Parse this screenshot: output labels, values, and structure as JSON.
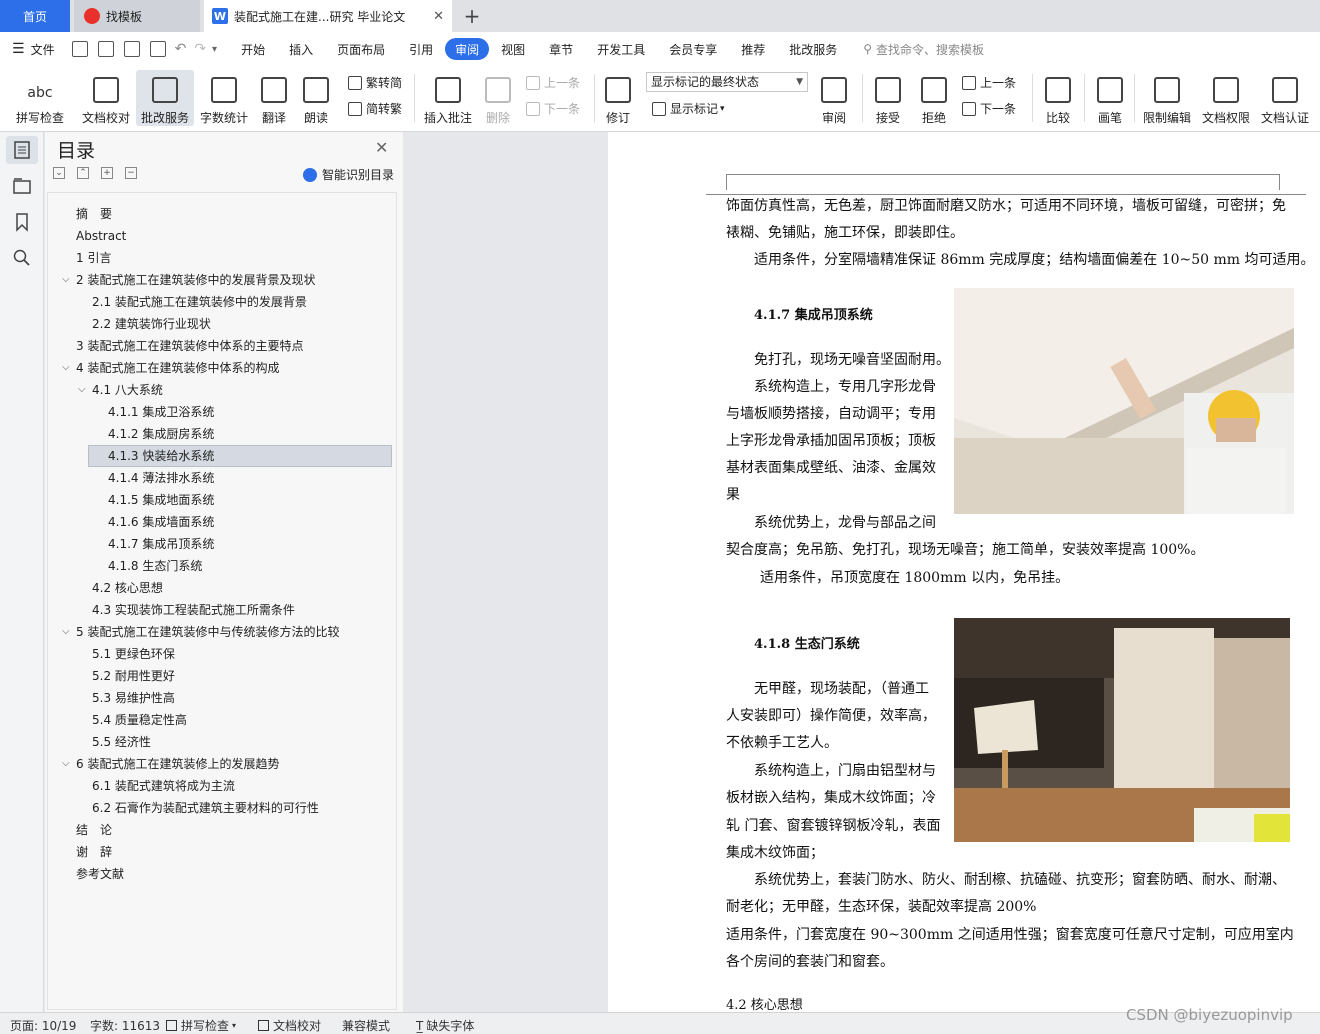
{
  "tabs": {
    "home": "首页",
    "templates": "找模板",
    "document": "装配式施工在建...研究 毕业论文"
  },
  "menu": {
    "file": "文件",
    "items": [
      "开始",
      "插入",
      "页面布局",
      "引用",
      "审阅",
      "视图",
      "章节",
      "开发工具",
      "会员专享",
      "推荐",
      "批改服务"
    ],
    "active": "审阅",
    "search_placeholder": "查找命令、搜索模板"
  },
  "ribbon": {
    "spellcheck": "拼写检查",
    "doc_proof": "文档校对",
    "correct_service": "批改服务",
    "word_count": "字数统计",
    "translate": "翻译",
    "read_aloud": "朗读",
    "trad_to_simp": "繁转简",
    "simp_to_trad": "简转繁",
    "insert_comment": "插入批注",
    "delete": "删除",
    "prev_comment": "上一条",
    "next_comment": "下一条",
    "revise": "修订",
    "markup_mode": "显示标记的最终状态",
    "show_markup": "显示标记",
    "review": "审阅",
    "accept": "接受",
    "reject": "拒绝",
    "prev_change": "上一条",
    "next_change": "下一条",
    "compare": "比较",
    "pen": "画笔",
    "restrict_edit": "限制编辑",
    "doc_rights": "文档权限",
    "doc_cert": "文档认证"
  },
  "nav": {
    "title": "目录",
    "smart_toc": "智能识别目录",
    "items": [
      {
        "text": "摘　要",
        "level": 1
      },
      {
        "text": "Abstract",
        "level": 1
      },
      {
        "text": "1 引言",
        "level": 1
      },
      {
        "text": "2 装配式施工在建筑装修中的发展背景及现状",
        "level": 1,
        "twisty": "⌵"
      },
      {
        "text": "2.1 装配式施工在建筑装修中的发展背景",
        "level": 2
      },
      {
        "text": "2.2 建筑装饰行业现状",
        "level": 2
      },
      {
        "text": "3 装配式施工在建筑装修中体系的主要特点",
        "level": 1
      },
      {
        "text": "4 装配式施工在建筑装修中体系的构成",
        "level": 1,
        "twisty": "⌵"
      },
      {
        "text": "4.1 八大系统",
        "level": 2,
        "twisty": "⌵"
      },
      {
        "text": "4.1.1 集成卫浴系统",
        "level": 3
      },
      {
        "text": "4.1.2 集成厨房系统",
        "level": 3
      },
      {
        "text": "4.1.3 快装给水系统",
        "level": 3,
        "selected": true
      },
      {
        "text": "4.1.4 薄法排水系统",
        "level": 3
      },
      {
        "text": "4.1.5 集成地面系统",
        "level": 3
      },
      {
        "text": "4.1.6 集成墙面系统",
        "level": 3
      },
      {
        "text": "4.1.7 集成吊顶系统",
        "level": 3
      },
      {
        "text": "4.1.8 生态门系统",
        "level": 3
      },
      {
        "text": "4.2 核心思想",
        "level": 2
      },
      {
        "text": "4.3 实现装饰工程装配式施工所需条件",
        "level": 2
      },
      {
        "text": "5 装配式施工在建筑装修中与传统装修方法的比较",
        "level": 1,
        "twisty": "⌵"
      },
      {
        "text": "5.1 更绿色环保",
        "level": 2
      },
      {
        "text": "5.2 耐用性更好",
        "level": 2
      },
      {
        "text": "5.3 易维护性高",
        "level": 2
      },
      {
        "text": "5.4 质量稳定性高",
        "level": 2
      },
      {
        "text": "5.5 经济性",
        "level": 2
      },
      {
        "text": "6 装配式施工在建筑装修上的发展趋势",
        "level": 1,
        "twisty": "⌵"
      },
      {
        "text": "6.1 装配式建筑将成为主流",
        "level": 2
      },
      {
        "text": "6.2 石膏作为装配式建筑主要材料的可行性",
        "level": 2
      },
      {
        "text": "结　论",
        "level": 1
      },
      {
        "text": "谢　辞",
        "level": 1
      },
      {
        "text": "参考文献",
        "level": 1
      }
    ]
  },
  "document": {
    "lines": [
      "饰面仿真性高，无色差，厨卫饰面耐磨又防水；可适用不同环境，墙板可留缝，可密拼；免",
      "裱糊、免铺贴，施工环保，即装即住。",
      "适用条件，分室隔墙精准保证 86mm 完成厚度；结构墙面偏差在 10~50 mm 均可适用。",
      "4.1.7 集成吊顶系统",
      "免打孔，现场无噪音坚固耐用。",
      "系统构造上，专用几字形龙骨",
      "与墙板顺势搭接，自动调平；专用",
      "上字形龙骨承插加固吊顶板；顶板",
      "基材表面集成壁纸、油漆、金属效",
      "果",
      "系统优势上，龙骨与部品之间",
      "契合度高；免吊筋、免打孔，现场无噪音；施工简单，安装效率提高 100%。",
      "适用条件，吊顶宽度在 1800mm 以内，免吊挂。",
      "4.1.8 生态门系统",
      "无甲醛，现场装配，（普通工",
      "人安装即可）操作简便，效率高，",
      "不依赖手工艺人。",
      "系统构造上，门扇由铝型材与",
      "板材嵌入结构，集成木纹饰面；冷",
      "轧 门套、窗套镀锌钢板冷轧，表面",
      "集成木纹饰面；",
      "系统优势上，套装门防水、防火、耐刮檫、抗磕碰、抗变形；窗套防晒、耐水、耐潮、",
      "耐老化；无甲醛，生态环保，装配效率提高 200%",
      "适用条件，门套宽度在 90~300mm 之间适用性强；窗套宽度可任意尺寸定制，可应用室内",
      "各个房间的套装门和窗套。",
      "4.2 核心思想"
    ]
  },
  "status": {
    "page": "页面: 10/19",
    "words": "字数: 11613",
    "spell": "拼写检查",
    "proof": "文档校对",
    "compat": "兼容模式",
    "missing_font": "缺失字体"
  },
  "watermark": "CSDN @biyezuopinvip"
}
